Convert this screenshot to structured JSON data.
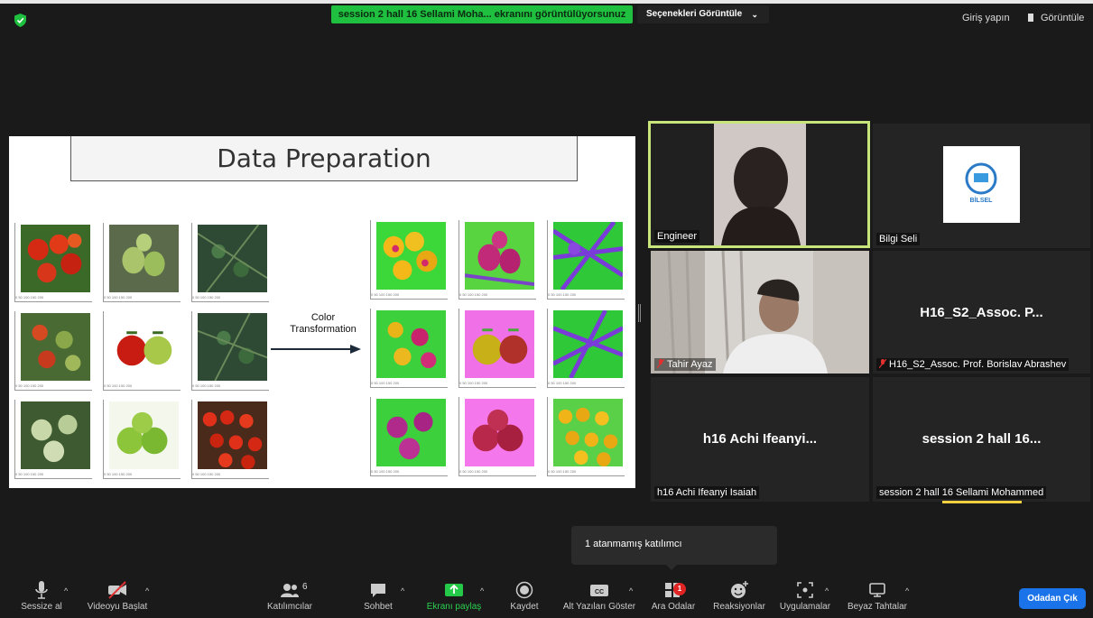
{
  "top": {
    "share_banner": "session 2  hall 16 Sellami Moha... ekranını görüntülüyorsunuz",
    "view_options": "Seçenekleri Görüntüle",
    "signin": "Giriş yapın",
    "view_button": "Görüntüle"
  },
  "slide": {
    "title": "Data Preparation",
    "arrow_label_1": "Color",
    "arrow_label_2": "Transformation",
    "tick_x": "0   50   100   150   200"
  },
  "participants": {
    "t1_name": "Engineer",
    "t2_name": "Bilgi Seli",
    "t2_logo_text": "BİLSEL",
    "t3_name": "Tahir Ayaz",
    "t4_big": "H16_S2_Assoc. P...",
    "t4_name": "H16_S2_Assoc. Prof. Borislav Abrashev",
    "t5_big": "h16 Achi Ifeanyi...",
    "t5_name": "h16 Achi Ifeanyi Isaiah",
    "t6_big": "session 2 hall 16...",
    "t6_name": "session 2 hall 16 Sellami Mohammed"
  },
  "tooltip": "1 atanmamış katılımcı",
  "toolbar": {
    "mute": "Sessize al",
    "video": "Videoyu Başlat",
    "participants": "Katılımcılar",
    "participants_count": "6",
    "chat": "Sohbet",
    "share": "Ekranı paylaş",
    "record": "Kaydet",
    "captions": "Alt Yazıları Göster",
    "cc": "CC",
    "breakout": "Ara Odalar",
    "breakout_badge": "1",
    "reactions": "Reaksiyonlar",
    "apps": "Uygulamalar",
    "whiteboard": "Beyaz Tahtalar",
    "leave": "Odadan Çık"
  },
  "colors": {
    "share_green": "#1fbf3f",
    "active_border": "#c7e57a",
    "leave_blue": "#1a73e8"
  }
}
